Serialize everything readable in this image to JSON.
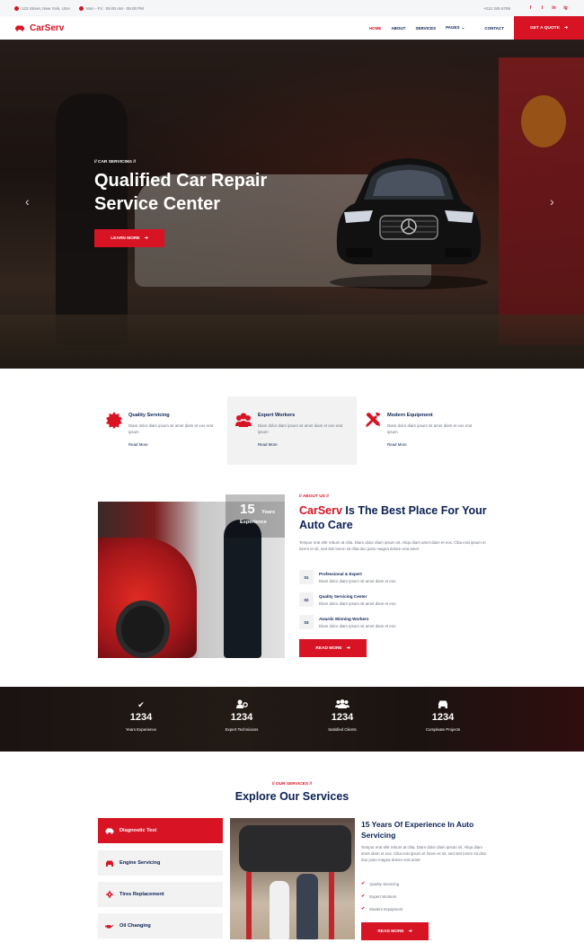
{
  "topbar": {
    "address": "123 Street, New York, USA",
    "hours": "Mon - Fri : 09.00 AM - 09.00 PM",
    "phone": "+012 345 6789",
    "social": [
      "f",
      "t",
      "in",
      "ig"
    ]
  },
  "nav": {
    "brand": "CarServ",
    "items": [
      "HOME",
      "ABOUT",
      "SERVICES",
      "PAGES",
      "CONTACT"
    ],
    "active": "HOME",
    "quote": "GET A QUOTE"
  },
  "hero": {
    "kicker": "// CAR SERVICING //",
    "title": "Qualified Car Repair Service Center",
    "button": "LEARN MORE"
  },
  "features": [
    {
      "title": "Quality Servicing",
      "text": "Diam dolor diam ipsum sit amet diam et eos erat ipsum",
      "link": "Read More",
      "icon": "certificate-icon"
    },
    {
      "title": "Expert Workers",
      "text": "Diam dolor diam ipsum sit amet diam et eos erat ipsum",
      "link": "Read More",
      "icon": "users-cog-icon"
    },
    {
      "title": "Modern Equipment",
      "text": "Diam dolor diam ipsum sit amet diam et eos erat ipsum",
      "link": "Read More",
      "icon": "tools-icon"
    }
  ],
  "about": {
    "years": "15",
    "years_label": "Years",
    "years_label2": "Experience",
    "kicker": "// ABOUT US //",
    "title_brand": "CarServ",
    "title_rest": " Is The Best Place For Your Auto Care",
    "text": "Tempor erat elitr rebum at clita. Diam dolor diam ipsum sit. Aliqu diam amet diam et eos. Clita erat ipsum et lorem et sit, sed stet lorem sit clita duo justo magna dolore erat amet",
    "items": [
      {
        "num": "01",
        "title": "Professional & Expert",
        "text": "Diam dolor diam ipsum sit amet diam et eos"
      },
      {
        "num": "02",
        "title": "Quality Servicing Center",
        "text": "Diam dolor diam ipsum sit amet diam et eos"
      },
      {
        "num": "03",
        "title": "Awards Winning Workers",
        "text": "Diam dolor diam ipsum sit amet diam et eos"
      }
    ],
    "button": "READ MORE"
  },
  "facts": [
    {
      "icon": "check-icon",
      "value": "1234",
      "label": "Years Experience"
    },
    {
      "icon": "users-cog-icon",
      "value": "1234",
      "label": "Expert Technicians"
    },
    {
      "icon": "users-icon",
      "value": "1234",
      "label": "Satisfied Clients"
    },
    {
      "icon": "car-icon",
      "value": "1234",
      "label": "Compleate Projects"
    }
  ],
  "services": {
    "kicker": "// OUR SERVICES //",
    "title": "Explore Our Services",
    "tabs": [
      {
        "label": "Diagnostic Test",
        "icon": "car-side-icon"
      },
      {
        "label": "Engine Servicing",
        "icon": "car-icon"
      },
      {
        "label": "Tires Replacement",
        "icon": "cog-icon"
      },
      {
        "label": "Oil Changing",
        "icon": "oil-can-icon"
      }
    ],
    "active_tab": "Diagnostic Test",
    "heading": "15 Years Of Experience In Auto Servicing",
    "text": "Tempor erat elitr rebum at clita. Diam dolor diam ipsum sit. Aliqu diam amet diam et eos. Clita erat ipsum et lorem et sit, sed stet lorem sit clita duo justo magna dolore erat amet",
    "list": [
      "Quality Servicing",
      "Expert Workers",
      "Modern Equipment"
    ],
    "button": "READ MORE"
  },
  "colors": {
    "accent": "#d81324",
    "dark": "#0b2154"
  }
}
